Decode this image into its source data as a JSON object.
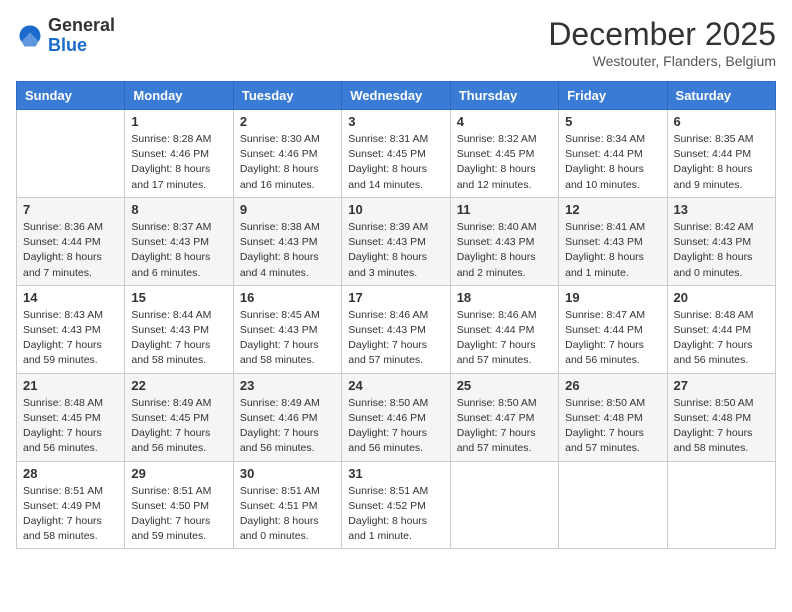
{
  "header": {
    "logo_line1": "General",
    "logo_line2": "Blue",
    "month": "December 2025",
    "location": "Westouter, Flanders, Belgium"
  },
  "weekdays": [
    "Sunday",
    "Monday",
    "Tuesday",
    "Wednesday",
    "Thursday",
    "Friday",
    "Saturday"
  ],
  "weeks": [
    [
      {
        "day": "",
        "content": ""
      },
      {
        "day": "1",
        "content": "Sunrise: 8:28 AM\nSunset: 4:46 PM\nDaylight: 8 hours\nand 17 minutes."
      },
      {
        "day": "2",
        "content": "Sunrise: 8:30 AM\nSunset: 4:46 PM\nDaylight: 8 hours\nand 16 minutes."
      },
      {
        "day": "3",
        "content": "Sunrise: 8:31 AM\nSunset: 4:45 PM\nDaylight: 8 hours\nand 14 minutes."
      },
      {
        "day": "4",
        "content": "Sunrise: 8:32 AM\nSunset: 4:45 PM\nDaylight: 8 hours\nand 12 minutes."
      },
      {
        "day": "5",
        "content": "Sunrise: 8:34 AM\nSunset: 4:44 PM\nDaylight: 8 hours\nand 10 minutes."
      },
      {
        "day": "6",
        "content": "Sunrise: 8:35 AM\nSunset: 4:44 PM\nDaylight: 8 hours\nand 9 minutes."
      }
    ],
    [
      {
        "day": "7",
        "content": "Sunrise: 8:36 AM\nSunset: 4:44 PM\nDaylight: 8 hours\nand 7 minutes."
      },
      {
        "day": "8",
        "content": "Sunrise: 8:37 AM\nSunset: 4:43 PM\nDaylight: 8 hours\nand 6 minutes."
      },
      {
        "day": "9",
        "content": "Sunrise: 8:38 AM\nSunset: 4:43 PM\nDaylight: 8 hours\nand 4 minutes."
      },
      {
        "day": "10",
        "content": "Sunrise: 8:39 AM\nSunset: 4:43 PM\nDaylight: 8 hours\nand 3 minutes."
      },
      {
        "day": "11",
        "content": "Sunrise: 8:40 AM\nSunset: 4:43 PM\nDaylight: 8 hours\nand 2 minutes."
      },
      {
        "day": "12",
        "content": "Sunrise: 8:41 AM\nSunset: 4:43 PM\nDaylight: 8 hours\nand 1 minute."
      },
      {
        "day": "13",
        "content": "Sunrise: 8:42 AM\nSunset: 4:43 PM\nDaylight: 8 hours\nand 0 minutes."
      }
    ],
    [
      {
        "day": "14",
        "content": "Sunrise: 8:43 AM\nSunset: 4:43 PM\nDaylight: 7 hours\nand 59 minutes."
      },
      {
        "day": "15",
        "content": "Sunrise: 8:44 AM\nSunset: 4:43 PM\nDaylight: 7 hours\nand 58 minutes."
      },
      {
        "day": "16",
        "content": "Sunrise: 8:45 AM\nSunset: 4:43 PM\nDaylight: 7 hours\nand 58 minutes."
      },
      {
        "day": "17",
        "content": "Sunrise: 8:46 AM\nSunset: 4:43 PM\nDaylight: 7 hours\nand 57 minutes."
      },
      {
        "day": "18",
        "content": "Sunrise: 8:46 AM\nSunset: 4:44 PM\nDaylight: 7 hours\nand 57 minutes."
      },
      {
        "day": "19",
        "content": "Sunrise: 8:47 AM\nSunset: 4:44 PM\nDaylight: 7 hours\nand 56 minutes."
      },
      {
        "day": "20",
        "content": "Sunrise: 8:48 AM\nSunset: 4:44 PM\nDaylight: 7 hours\nand 56 minutes."
      }
    ],
    [
      {
        "day": "21",
        "content": "Sunrise: 8:48 AM\nSunset: 4:45 PM\nDaylight: 7 hours\nand 56 minutes."
      },
      {
        "day": "22",
        "content": "Sunrise: 8:49 AM\nSunset: 4:45 PM\nDaylight: 7 hours\nand 56 minutes."
      },
      {
        "day": "23",
        "content": "Sunrise: 8:49 AM\nSunset: 4:46 PM\nDaylight: 7 hours\nand 56 minutes."
      },
      {
        "day": "24",
        "content": "Sunrise: 8:50 AM\nSunset: 4:46 PM\nDaylight: 7 hours\nand 56 minutes."
      },
      {
        "day": "25",
        "content": "Sunrise: 8:50 AM\nSunset: 4:47 PM\nDaylight: 7 hours\nand 57 minutes."
      },
      {
        "day": "26",
        "content": "Sunrise: 8:50 AM\nSunset: 4:48 PM\nDaylight: 7 hours\nand 57 minutes."
      },
      {
        "day": "27",
        "content": "Sunrise: 8:50 AM\nSunset: 4:48 PM\nDaylight: 7 hours\nand 58 minutes."
      }
    ],
    [
      {
        "day": "28",
        "content": "Sunrise: 8:51 AM\nSunset: 4:49 PM\nDaylight: 7 hours\nand 58 minutes."
      },
      {
        "day": "29",
        "content": "Sunrise: 8:51 AM\nSunset: 4:50 PM\nDaylight: 7 hours\nand 59 minutes."
      },
      {
        "day": "30",
        "content": "Sunrise: 8:51 AM\nSunset: 4:51 PM\nDaylight: 8 hours\nand 0 minutes."
      },
      {
        "day": "31",
        "content": "Sunrise: 8:51 AM\nSunset: 4:52 PM\nDaylight: 8 hours\nand 1 minute."
      },
      {
        "day": "",
        "content": ""
      },
      {
        "day": "",
        "content": ""
      },
      {
        "day": "",
        "content": ""
      }
    ]
  ]
}
